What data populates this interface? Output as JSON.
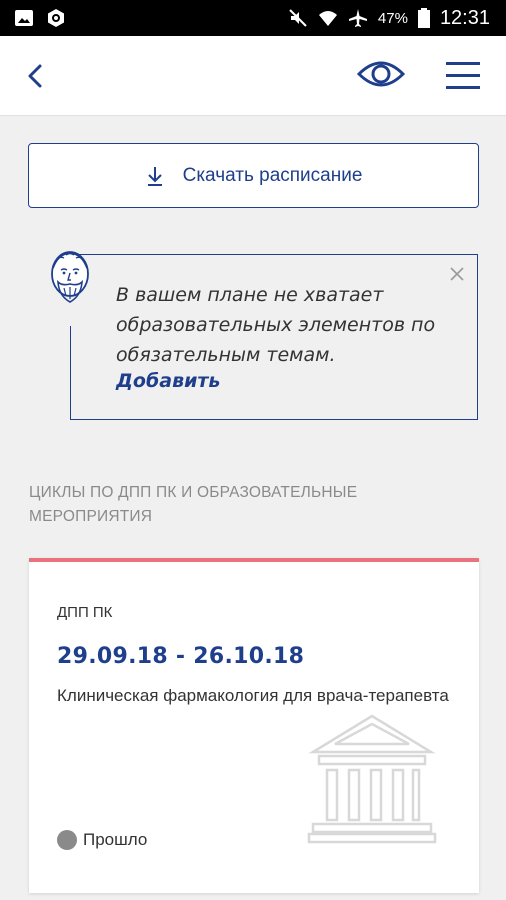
{
  "status_bar": {
    "battery": "47%",
    "time": "12:31"
  },
  "toolbar": {
    "back_icon": "chevron-left-icon",
    "view_icon": "eye-icon",
    "menu_icon": "hamburger-menu-icon"
  },
  "download_button": {
    "label": "Скачать расписание",
    "icon": "download-icon"
  },
  "notice": {
    "text": "В вашем плане не хватает образовательных элементов по обязательным темам.",
    "link": "Добавить",
    "avatar_icon": "scholar-avatar-icon",
    "close_icon": "close-icon"
  },
  "section": {
    "title": "ЦИКЛЫ ПО ДПП ПК И ОБРАЗОВАТЕЛЬНЫЕ МЕРОПРИЯТИЯ"
  },
  "card": {
    "type": "ДПП ПК",
    "dates": "29.09.18 - 26.10.18",
    "title": "Клиническая фармакология для врача-терапевта",
    "status": "Прошло",
    "accent_color": "#e8737f",
    "status_color": "#8a8a8a"
  },
  "colors": {
    "primary": "#1f3f8c",
    "background": "#f0f0f0"
  }
}
